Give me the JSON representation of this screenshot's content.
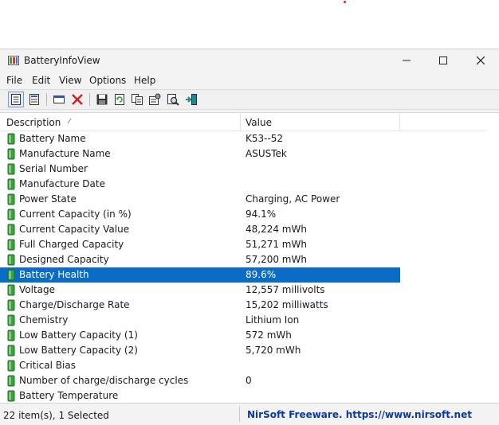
{
  "window": {
    "title": "BatteryInfoView"
  },
  "menu": [
    "File",
    "Edit",
    "View",
    "Options",
    "Help"
  ],
  "toolbar_icons": [
    "properties-icon",
    "html-report-icon",
    "options-icon",
    "delete-icon",
    "save-icon",
    "refresh-icon",
    "copy-icon",
    "settings-icon",
    "find-icon",
    "exit-icon"
  ],
  "list": {
    "columns": {
      "description": "Description",
      "value": "Value"
    },
    "selected_index": 9,
    "rows": [
      {
        "description": "Battery Name",
        "value": "K53--52"
      },
      {
        "description": "Manufacture Name",
        "value": "ASUSTek"
      },
      {
        "description": "Serial Number",
        "value": ""
      },
      {
        "description": "Manufacture Date",
        "value": ""
      },
      {
        "description": "Power State",
        "value": "Charging, AC Power"
      },
      {
        "description": "Current Capacity (in %)",
        "value": "94.1%"
      },
      {
        "description": "Current Capacity Value",
        "value": "48,224 mWh"
      },
      {
        "description": "Full Charged Capacity",
        "value": "51,271 mWh"
      },
      {
        "description": "Designed Capacity",
        "value": "57,200 mWh"
      },
      {
        "description": "Battery Health",
        "value": "89.6%"
      },
      {
        "description": "Voltage",
        "value": "12,557 millivolts"
      },
      {
        "description": "Charge/Discharge Rate",
        "value": "15,202 milliwatts"
      },
      {
        "description": "Chemistry",
        "value": "Lithium Ion"
      },
      {
        "description": "Low Battery Capacity (1)",
        "value": "572 mWh"
      },
      {
        "description": "Low Battery Capacity (2)",
        "value": "5,720 mWh"
      },
      {
        "description": "Critical Bias",
        "value": ""
      },
      {
        "description": "Number of charge/discharge cycles",
        "value": "0"
      },
      {
        "description": "Battery Temperature",
        "value": ""
      }
    ]
  },
  "status": {
    "items": "22 item(s), 1 Selected",
    "credit": "NirSoft Freeware. https://www.nirsoft.net"
  },
  "colors": {
    "selection": "#0b6cc6",
    "battery_green": "#3aa33a",
    "credit_link": "#0b3aa8"
  }
}
